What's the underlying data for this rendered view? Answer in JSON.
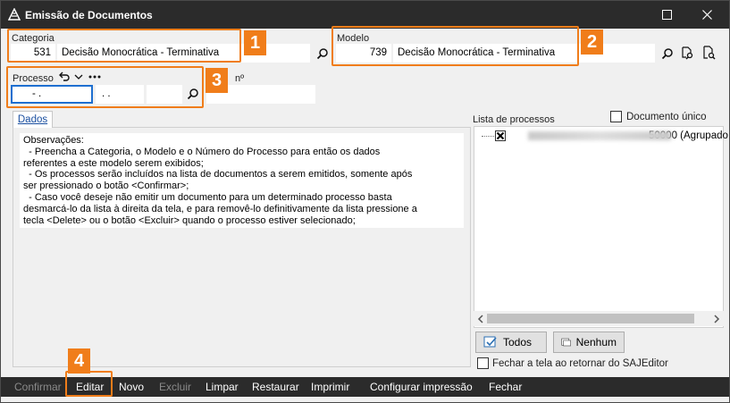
{
  "window": {
    "title": "Emissão de Documentos"
  },
  "categoria": {
    "label": "Categoria",
    "code": "531",
    "description": "Decisão Monocrática - Terminativa"
  },
  "modelo": {
    "label": "Modelo",
    "code": "739",
    "description": "Decisão Monocrática - Terminativa"
  },
  "processo": {
    "label": "Processo",
    "field1": " - .",
    "field2": ". .",
    "field3": "",
    "extra_label": "nº",
    "extra_value": ""
  },
  "tabs": [
    {
      "label": "Dados"
    }
  ],
  "observacoes": {
    "lines": [
      "Observações:",
      "  - Preencha a Categoria, o Modelo e o Número do Processo para então os dados",
      "referentes a este modelo serem exibidos;",
      "  - Os processos serão incluídos na lista de documentos a serem emitidos, somente após",
      "ser pressionado o botão <Confirmar>;",
      "  - Caso você deseje não emitir um documento para um determinado processo basta",
      "desmarcá-lo da lista à direita da tela, e para removê-lo definitivamente da lista pressione a",
      "tecla <Delete> ou o botão <Excluir> quando o processo estiver selecionado;"
    ]
  },
  "lista": {
    "label": "Lista de processos",
    "documento_unico_label": "Documento único",
    "items": [
      {
        "suffix": "50000 (Agrupado"
      }
    ],
    "todos_label": "Todos",
    "nenhum_label": "Nenhum"
  },
  "fechar_option": {
    "label": "Fechar a tela ao retornar do SAJEditor"
  },
  "callouts": [
    "1",
    "2",
    "3",
    "4"
  ],
  "toolbar": {
    "confirmar": "Confirmar",
    "editar": "Editar",
    "novo": "Novo",
    "excluir": "Excluir",
    "limpar": "Limpar",
    "restaurar": "Restaurar",
    "imprimir": "Imprimir",
    "configurar": "Configurar impressão",
    "fechar": "Fechar"
  },
  "colors": {
    "accent": "#f07d1a",
    "titlebar": "#2b2b2b",
    "focus": "#1e6fd0"
  }
}
